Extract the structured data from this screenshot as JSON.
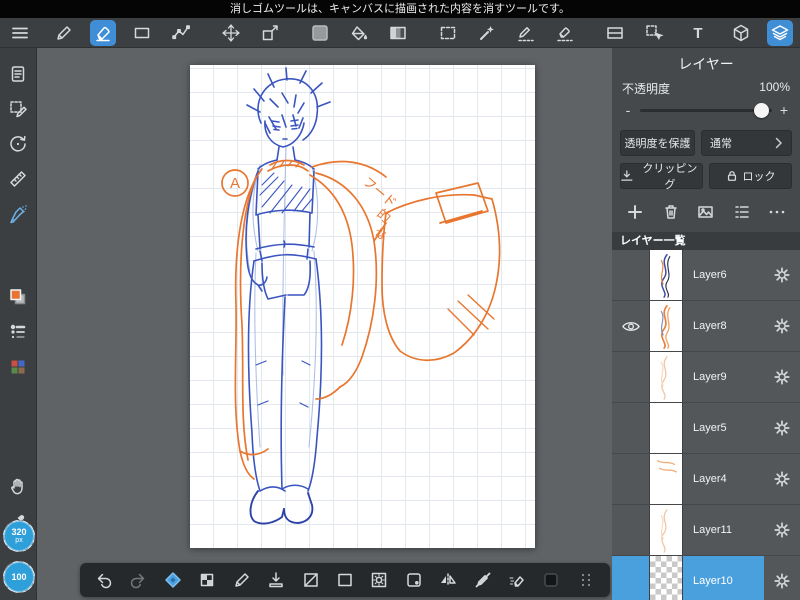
{
  "banner": {
    "message": "消しゴムツールは、キャンバスに描画された内容を消すツールです。"
  },
  "toolbar": {
    "text_tool_label": "T",
    "icons": [
      "menu",
      "pen",
      "eraser",
      "rectangle",
      "polyline",
      "move",
      "transform",
      "color-swatch",
      "bucket-fill",
      "gradient",
      "select-rect",
      "magic-wand",
      "select-pen",
      "select-eraser",
      "split-view",
      "select-cursor",
      "text",
      "material-cube",
      "layers"
    ],
    "active_tool": "eraser",
    "active_panel": "layers"
  },
  "sidebar": {
    "icons": [
      "document",
      "select-pen",
      "rotate-reset",
      "ruler",
      "airbrush",
      "foreground-color",
      "brush-sizes",
      "palette",
      "hand",
      "eyedropper"
    ],
    "brush_size_badge": {
      "value": "320",
      "unit": "px"
    },
    "secondary_badge": {
      "value": "100"
    }
  },
  "canvas": {
    "annotations": {
      "circle_label": "A",
      "note_line1": "フード",
      "note_line2": "的",
      "note_line3": "な"
    }
  },
  "bottom_bar": {
    "icons": [
      "undo",
      "redo",
      "pen-tip",
      "transparent-color",
      "pen",
      "merge-down",
      "line-tool",
      "shape",
      "filter",
      "rounded-rect",
      "flip",
      "draw-disable",
      "eraser-wipe",
      "material",
      "drag-handle"
    ]
  },
  "layers_panel": {
    "title": "レイヤー",
    "opacity": {
      "label": "不透明度",
      "value": "100%",
      "minus": "-",
      "plus": "+"
    },
    "buttons": {
      "protect_alpha": "透明度を保護",
      "blend_mode": "通常",
      "clipping": "クリッピング",
      "lock": "ロック"
    },
    "action_icons": [
      "add-layer",
      "delete-layer",
      "import-image",
      "layer-list-options",
      "more"
    ],
    "list_header": "レイヤー一覧",
    "layers": [
      {
        "name": "Layer6",
        "visible": false,
        "selected": false,
        "thumb": "blue-sketch"
      },
      {
        "name": "Layer8",
        "visible": true,
        "selected": false,
        "thumb": "orange-sketch"
      },
      {
        "name": "Layer9",
        "visible": false,
        "selected": false,
        "thumb": "faint-orange"
      },
      {
        "name": "Layer5",
        "visible": false,
        "selected": false,
        "thumb": "white"
      },
      {
        "name": "Layer4",
        "visible": false,
        "selected": false,
        "thumb": "orange-top"
      },
      {
        "name": "Layer11",
        "visible": false,
        "selected": false,
        "thumb": "faint-orange"
      },
      {
        "name": "Layer10",
        "visible": false,
        "selected": true,
        "thumb": "checker"
      }
    ]
  },
  "colors": {
    "accent_blue": "#4aa0dc",
    "sketch_blue": "#3a55c0",
    "sketch_orange": "#e8762e"
  }
}
